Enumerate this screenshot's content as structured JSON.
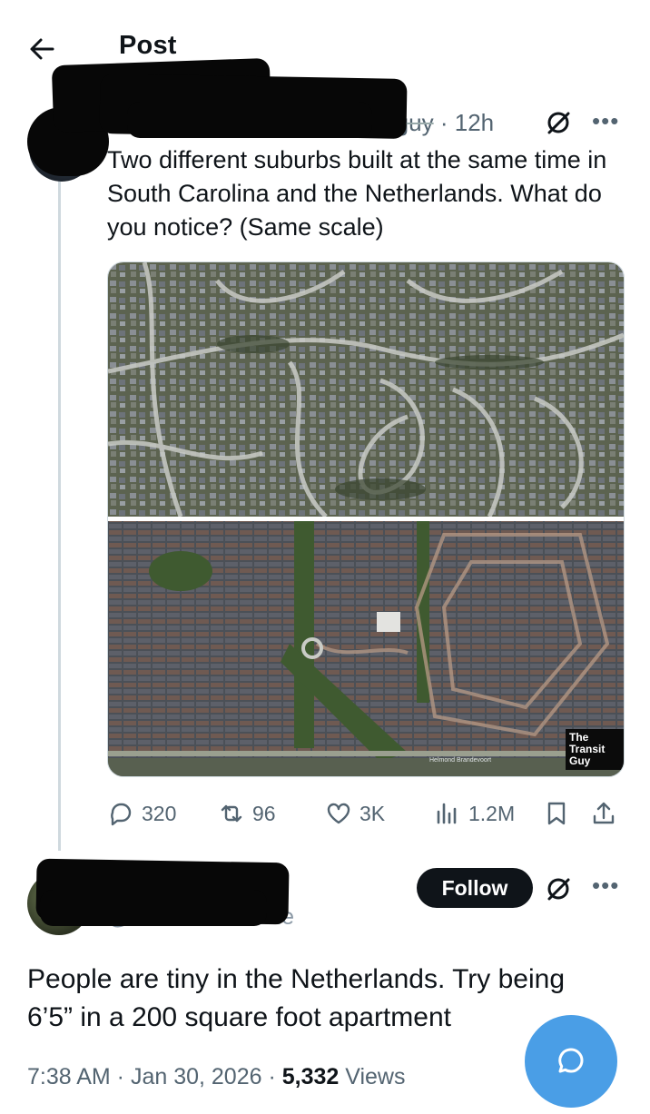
{
  "header": {
    "title": "Post",
    "back_icon": "arrow-left-icon"
  },
  "post": {
    "handle_visible": "t_guy",
    "time": "12h",
    "separator": "·",
    "text": "Two different suburbs built at the same time in South Carolina and the Netherlands. What do you notice? (Same scale)",
    "media": {
      "watermark": [
        "The",
        "Transit",
        "Guy"
      ],
      "caption_small": "Helmond Brandevoort"
    },
    "stats": {
      "replies": "320",
      "reposts": "96",
      "likes": "3K",
      "views": "1.2M"
    }
  },
  "reply": {
    "handle_visible": "@oversizedcanine",
    "follow_label": "Follow",
    "text": "People are tiny in the Netherlands. Try being 6’5” in a 200 square foot apartment",
    "timestamp": "7:38 AM · Jan 30, 2026 · ",
    "views_count": "5,332",
    "views_label": " Views"
  },
  "colors": {
    "accent": "#4a9ee6",
    "text": "#0f1419",
    "muted": "#536471",
    "line": "#cfd9de"
  }
}
